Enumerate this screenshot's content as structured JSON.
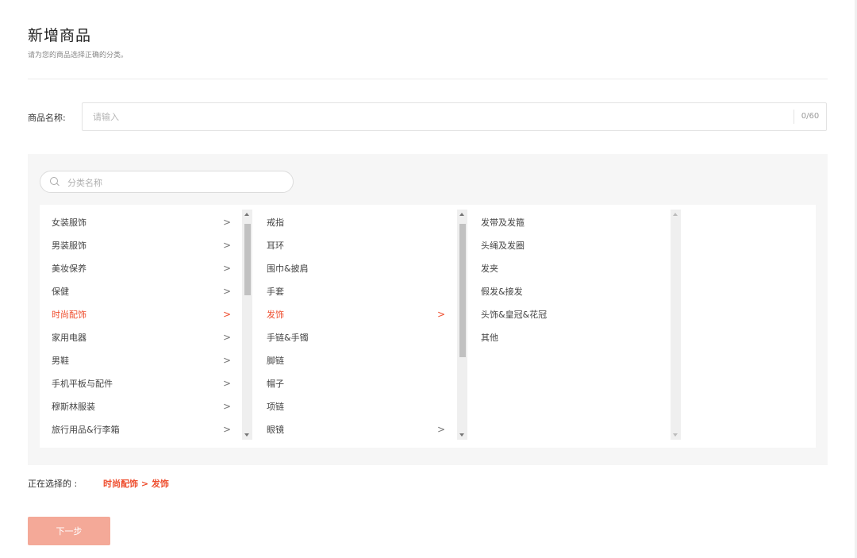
{
  "page": {
    "title": "新增商品",
    "subtitle": "请为您的商品选择正确的分类。"
  },
  "product_name": {
    "label": "商品名称:",
    "placeholder": "请输入",
    "value": "",
    "counter": "0/60"
  },
  "category_search": {
    "placeholder": "分类名称",
    "value": ""
  },
  "columns": {
    "level1": [
      {
        "label": "女装服饰",
        "has_children": true,
        "active": false
      },
      {
        "label": "男装服饰",
        "has_children": true,
        "active": false
      },
      {
        "label": "美妆保养",
        "has_children": true,
        "active": false
      },
      {
        "label": "保健",
        "has_children": true,
        "active": false
      },
      {
        "label": "时尚配饰",
        "has_children": true,
        "active": true
      },
      {
        "label": "家用电器",
        "has_children": true,
        "active": false
      },
      {
        "label": "男鞋",
        "has_children": true,
        "active": false
      },
      {
        "label": "手机平板与配件",
        "has_children": true,
        "active": false
      },
      {
        "label": "穆斯林服装",
        "has_children": true,
        "active": false
      },
      {
        "label": "旅行用品&行李箱",
        "has_children": true,
        "active": false
      }
    ],
    "level2": [
      {
        "label": "戒指",
        "has_children": false,
        "active": false
      },
      {
        "label": "耳环",
        "has_children": false,
        "active": false
      },
      {
        "label": "围巾&披肩",
        "has_children": false,
        "active": false
      },
      {
        "label": "手套",
        "has_children": false,
        "active": false
      },
      {
        "label": "发饰",
        "has_children": true,
        "active": true
      },
      {
        "label": "手链&手镯",
        "has_children": false,
        "active": false
      },
      {
        "label": "脚链",
        "has_children": false,
        "active": false
      },
      {
        "label": "帽子",
        "has_children": false,
        "active": false
      },
      {
        "label": "项链",
        "has_children": false,
        "active": false
      },
      {
        "label": "眼镜",
        "has_children": true,
        "active": false
      }
    ],
    "level3": [
      {
        "label": "发带及发箍",
        "has_children": false,
        "active": false
      },
      {
        "label": "头绳及发圈",
        "has_children": false,
        "active": false
      },
      {
        "label": "发夹",
        "has_children": false,
        "active": false
      },
      {
        "label": "假发&接发",
        "has_children": false,
        "active": false
      },
      {
        "label": "头饰&皇冠&花冠",
        "has_children": false,
        "active": false
      },
      {
        "label": "其他",
        "has_children": false,
        "active": false
      }
    ],
    "chevron": ">"
  },
  "selection": {
    "label": "正在选择的 :",
    "path": "时尚配饰 > 发饰"
  },
  "actions": {
    "next_label": "下一步"
  },
  "colors": {
    "accent": "#ee4d2d",
    "button_disabled": "#f4a998",
    "panel_bg": "#f6f6f6"
  }
}
